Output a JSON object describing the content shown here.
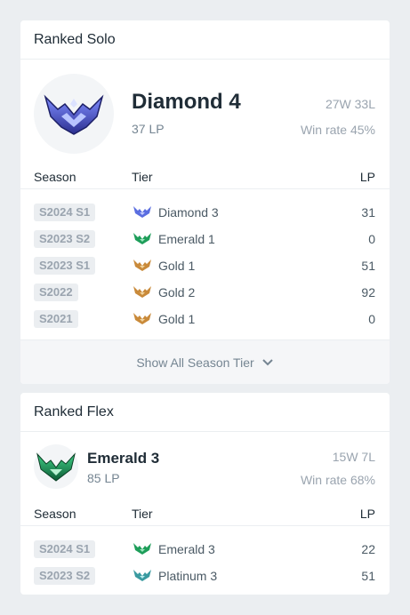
{
  "solo": {
    "title": "Ranked Solo",
    "tier": "Diamond 4",
    "lp": "37 LP",
    "record": "27W 33L",
    "win_rate": "Win rate 45%",
    "emblem": "diamond-emblem-icon",
    "columns": {
      "season": "Season",
      "tier": "Tier",
      "lp": "LP"
    },
    "history": [
      {
        "season": "S2024 S1",
        "tier": "Diamond 3",
        "lp": "31",
        "icon": "diamond-icon"
      },
      {
        "season": "S2023 S2",
        "tier": "Emerald 1",
        "lp": "0",
        "icon": "emerald-icon"
      },
      {
        "season": "S2023 S1",
        "tier": "Gold 1",
        "lp": "51",
        "icon": "gold-icon"
      },
      {
        "season": "S2022",
        "tier": "Gold 2",
        "lp": "92",
        "icon": "gold-icon"
      },
      {
        "season": "S2021",
        "tier": "Gold 1",
        "lp": "0",
        "icon": "gold-icon"
      }
    ],
    "show_all": "Show All Season Tier"
  },
  "flex": {
    "title": "Ranked Flex",
    "tier": "Emerald 3",
    "lp": "85 LP",
    "record": "15W 7L",
    "win_rate": "Win rate 68%",
    "emblem": "emerald-emblem-icon",
    "columns": {
      "season": "Season",
      "tier": "Tier",
      "lp": "LP"
    },
    "history": [
      {
        "season": "S2024 S1",
        "tier": "Emerald 3",
        "lp": "22",
        "icon": "emerald-icon"
      },
      {
        "season": "S2023 S2",
        "tier": "Platinum 3",
        "lp": "51",
        "icon": "platinum-icon"
      }
    ]
  },
  "colors": {
    "diamond": "#5b6ee0",
    "emerald": "#1e9e5a",
    "gold": "#c98a3a",
    "platinum": "#3a9aa0"
  }
}
